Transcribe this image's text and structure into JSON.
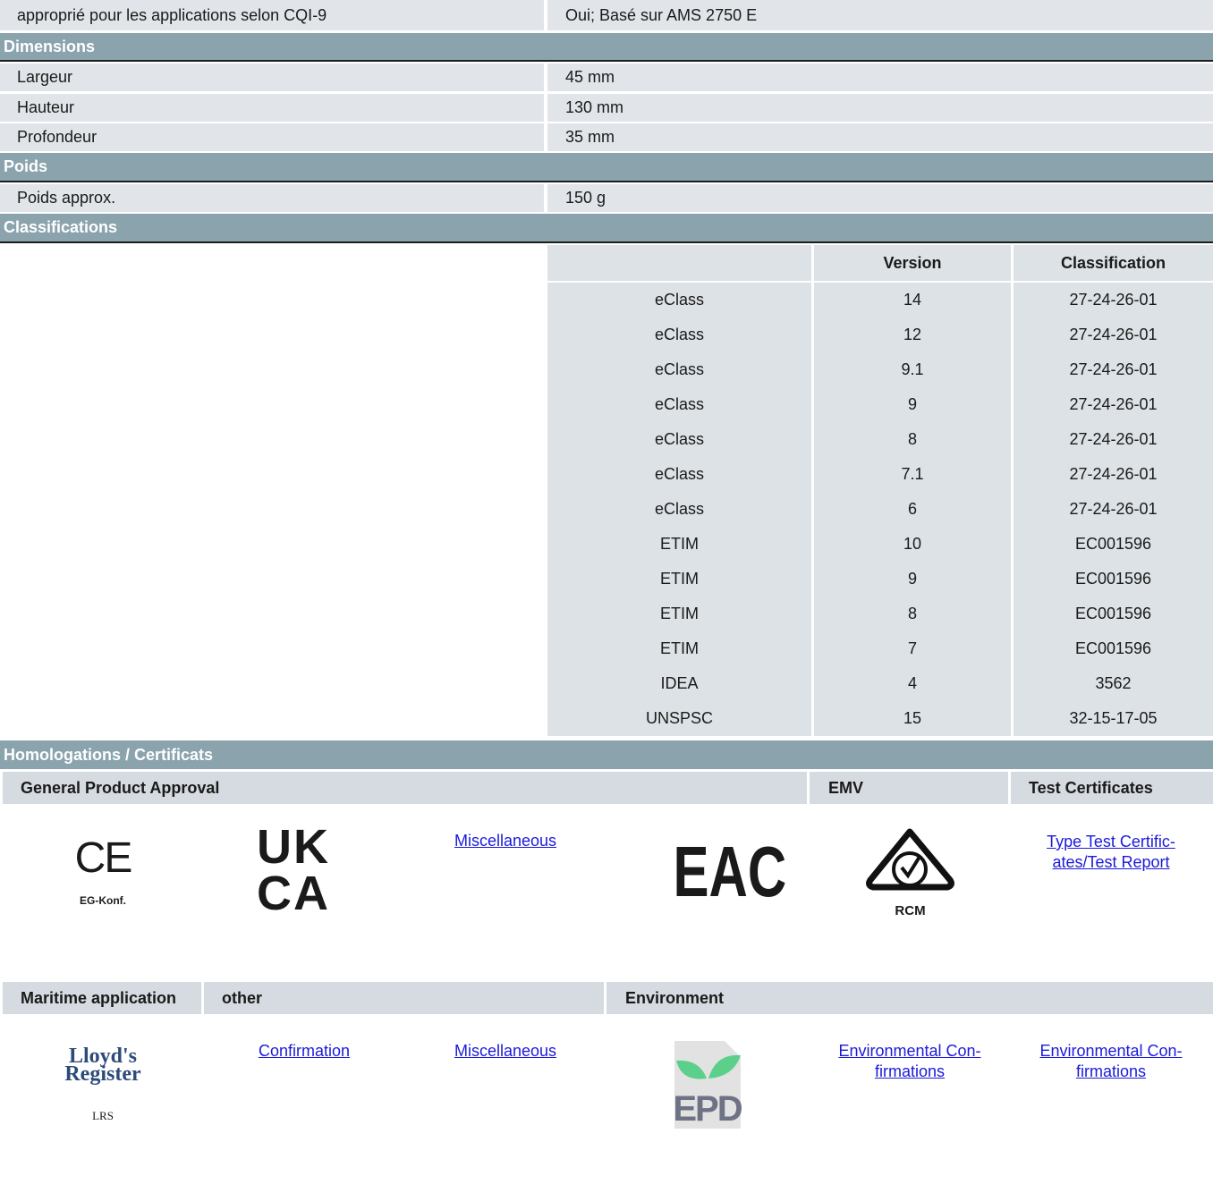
{
  "top_row": {
    "label": "approprié pour les applications selon CQI-9",
    "value": "Oui; Basé sur AMS 2750 E"
  },
  "sections": {
    "dimensions": "Dimensions",
    "poids": "Poids",
    "classifications": "Classifications",
    "homologations": "Homologations / Certificats"
  },
  "dimensions": [
    {
      "label": "Largeur",
      "value": "45 mm"
    },
    {
      "label": "Hauteur",
      "value": "130 mm"
    },
    {
      "label": "Profondeur",
      "value": "35 mm"
    }
  ],
  "poids": [
    {
      "label": "Poids approx.",
      "value": "150 g"
    }
  ],
  "classification_table": {
    "headers": [
      "",
      "Version",
      "Classification"
    ],
    "rows": [
      [
        "eClass",
        "14",
        "27-24-26-01"
      ],
      [
        "eClass",
        "12",
        "27-24-26-01"
      ],
      [
        "eClass",
        "9.1",
        "27-24-26-01"
      ],
      [
        "eClass",
        "9",
        "27-24-26-01"
      ],
      [
        "eClass",
        "8",
        "27-24-26-01"
      ],
      [
        "eClass",
        "7.1",
        "27-24-26-01"
      ],
      [
        "eClass",
        "6",
        "27-24-26-01"
      ],
      [
        "ETIM",
        "10",
        "EC001596"
      ],
      [
        "ETIM",
        "9",
        "EC001596"
      ],
      [
        "ETIM",
        "8",
        "EC001596"
      ],
      [
        "ETIM",
        "7",
        "EC001596"
      ],
      [
        "IDEA",
        "4",
        "3562"
      ],
      [
        "UNSPSC",
        "15",
        "32-15-17-05"
      ]
    ]
  },
  "approvals": {
    "row1_headers": {
      "general": "General Product Approval",
      "emv": "EMV",
      "test": "Test Certificates"
    },
    "row2_headers": {
      "maritime": "Maritime application",
      "other": "other",
      "environment": "Environment"
    },
    "ce": {
      "mark": "CE",
      "caption": "EG-Konf."
    },
    "ukca": {
      "line1": "UK",
      "line2": "CA"
    },
    "eac": {
      "mark": "EAC"
    },
    "rcm": {
      "caption": "RCM"
    },
    "lloyds": {
      "line1": "Lloyd's",
      "line2": "Register",
      "caption": "LRS"
    },
    "epd": {
      "mark": "EPD"
    },
    "links": {
      "misc1": "Miscellaneous",
      "type_test_1": "Type Test Certific-",
      "type_test_2": "ates/Test Report",
      "confirmation": "Confirmation",
      "misc2": "Miscellaneous",
      "env1_1": "Environmental Con-",
      "env1_2": "firmations",
      "env2_1": "Environmental Con-",
      "env2_2": "firmations"
    }
  }
}
